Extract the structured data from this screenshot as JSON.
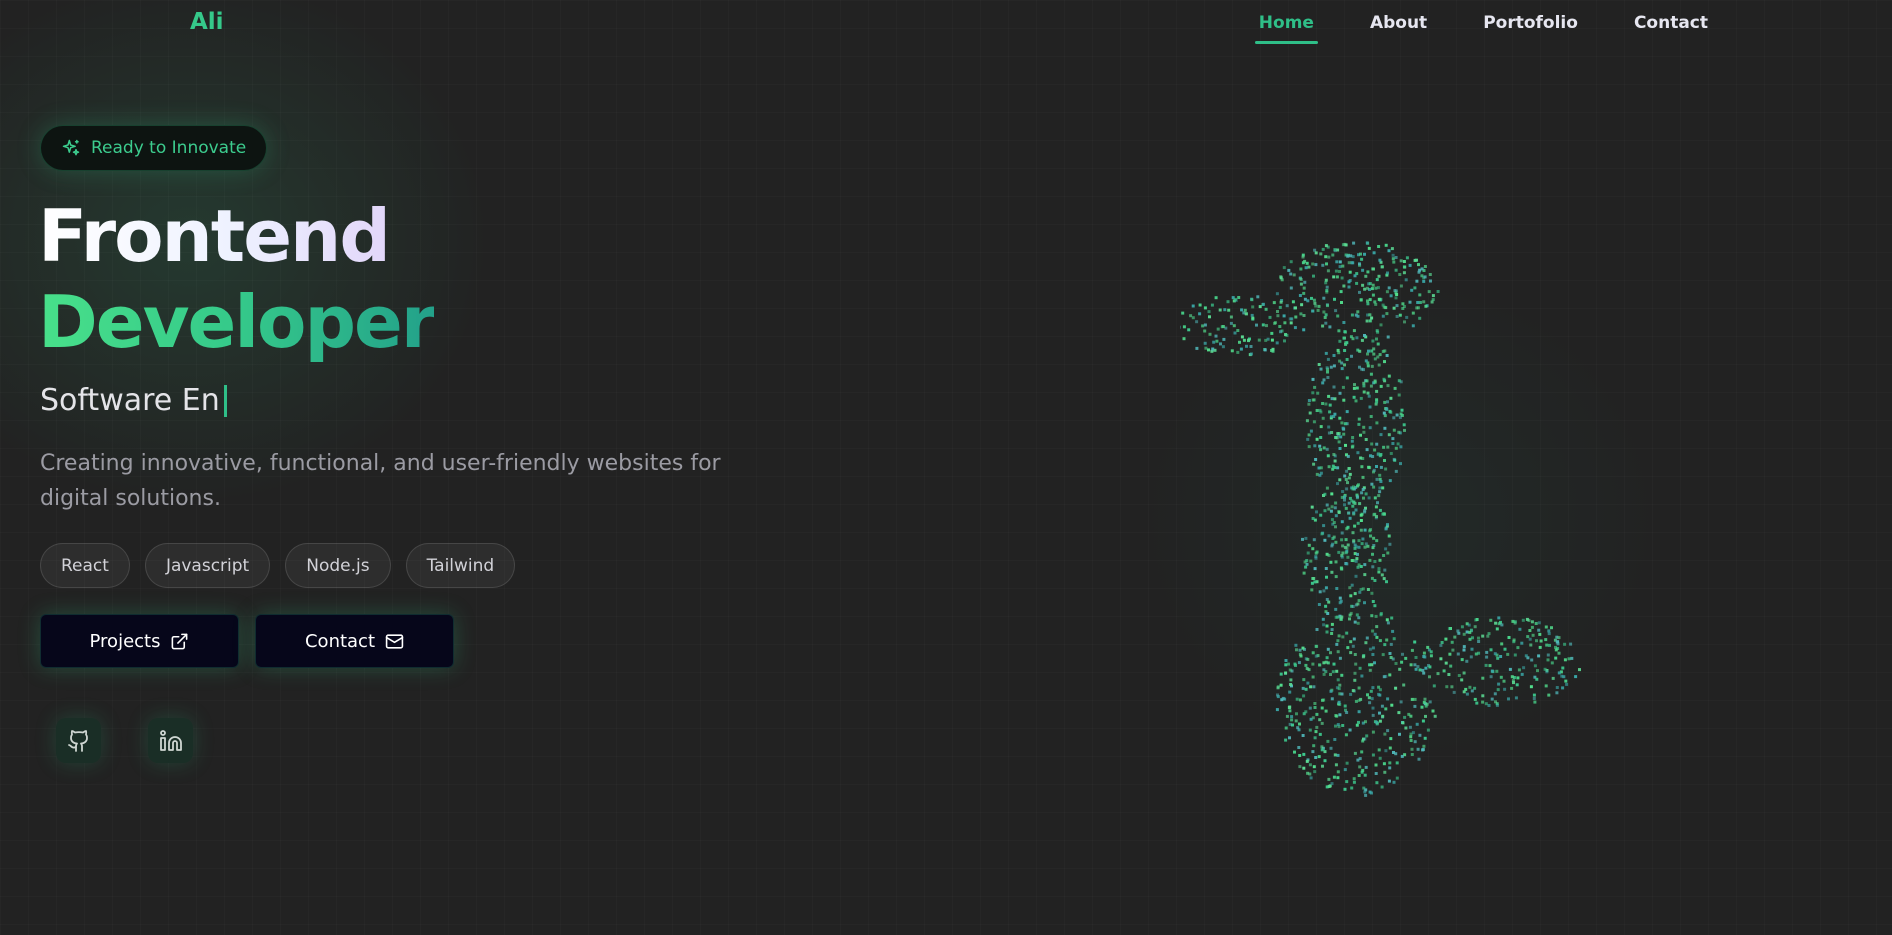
{
  "nav": {
    "logo": "Ali",
    "links": [
      {
        "label": "Home",
        "active": true
      },
      {
        "label": "About",
        "active": false
      },
      {
        "label": "Portofolio",
        "active": false
      },
      {
        "label": "Contact",
        "active": false
      }
    ]
  },
  "hero": {
    "badge": {
      "label": "Ready to Innovate",
      "icon": "sparkles-icon"
    },
    "title_line1": "Frontend",
    "title_line2": "Developer",
    "typing_text": "Software En",
    "description": "Creating innovative, functional, and user-friendly websites for digital solutions.",
    "tags": [
      "React",
      "Javascript",
      "Node.js",
      "Tailwind"
    ],
    "buttons": [
      {
        "label": "Projects",
        "icon": "external-link-icon"
      },
      {
        "label": "Contact",
        "icon": "mail-icon"
      }
    ],
    "socials": [
      {
        "icon": "github-icon"
      },
      {
        "icon": "linkedin-icon"
      }
    ]
  },
  "theme": {
    "background": "#222222",
    "accent": "#2fbf88",
    "accent_light": "#48e08a",
    "button_bg": "#06061a"
  }
}
